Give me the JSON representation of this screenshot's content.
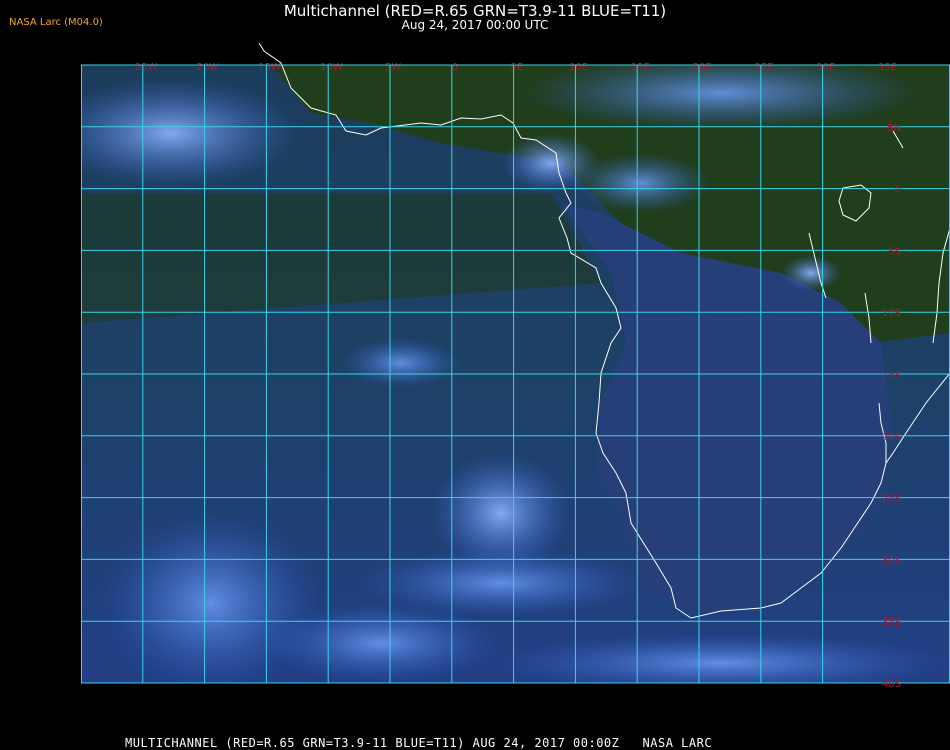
{
  "header": {
    "title": "Multichannel (RED=R.65 GRN=T3.9-11 BLUE=T11)",
    "subtitle": "Aug 24, 2017 00:00 UTC",
    "credit": "NASA Larc (M04.0)"
  },
  "footer": {
    "caption": "MULTICHANNEL (RED=R.65 GRN=T3.9-11 BLUE=T11) AUG 24, 2017 00:00Z   NASA LARC"
  },
  "map": {
    "longitude_labels": [
      "25W",
      "20W",
      "15W",
      "10W",
      "5W",
      "0",
      "5E",
      "10E",
      "15E",
      "20E",
      "25E",
      "30E",
      "35E"
    ],
    "latitude_labels": [
      "5N",
      "0",
      "5S",
      "10S",
      "15S",
      "20S",
      "25S",
      "30S",
      "35S",
      "40S"
    ],
    "colors": {
      "grid": "#35d6e8",
      "coastline": "#ffffff",
      "labels": "#c0102a",
      "ocean": "#1d3f5e",
      "land": "#1f3d1a",
      "cloud": "#3d6fe0"
    }
  }
}
